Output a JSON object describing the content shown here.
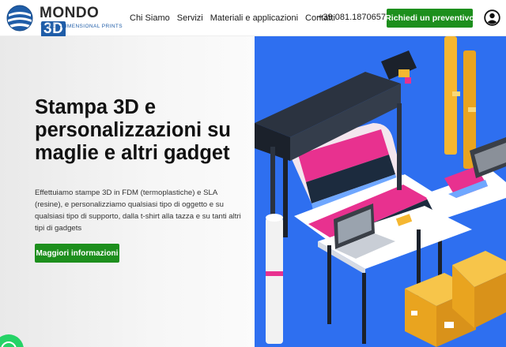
{
  "header": {
    "logo": {
      "word": "MONDO",
      "accent": "3D",
      "tagline": "THREE-DIMENSIONAL PRINTS"
    },
    "nav": [
      "Chi Siamo",
      "Servizi",
      "Materiali e applicazioni",
      "Contatti"
    ],
    "phone": "+39 081.18706577",
    "cta_label": "Richiedi un preventivo",
    "account_icon": "user-circle-icon"
  },
  "hero": {
    "title": "Stampa 3D e personalizzazioni su maglie e altri gadget",
    "text": "Effettuiamo stampe 3D in FDM (termoplastiche) e SLA (resine), e personalizziamo qualsiasi tipo di oggetto e su qualsiasi tipo di supporto, dalla t-shirt alla tazza e su tanti altri tipi di gadgets",
    "button_label": "Maggiori informazioni",
    "illustration": "wide-format-printer-laptop-boxes-illustration"
  },
  "floating": {
    "icon": "whatsapp-icon"
  },
  "colors": {
    "brand_blue": "#1f5da8",
    "cta_green": "#1d8f1d",
    "hero_blue": "#2e6ff0",
    "accent_magenta": "#e8318f",
    "box_yellow": "#f5b731"
  }
}
